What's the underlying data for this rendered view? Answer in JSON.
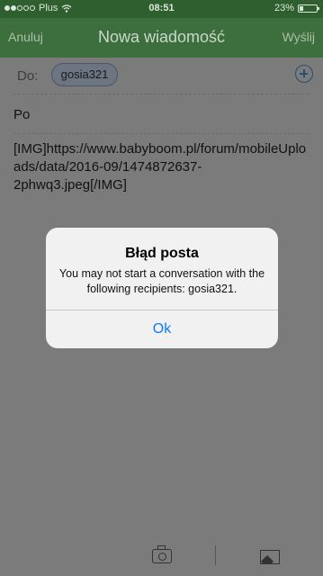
{
  "status_bar": {
    "carrier": "Plus",
    "time": "08:51",
    "battery_percent": "23%",
    "battery_level": 0.23,
    "signal_filled_dots": 2,
    "signal_total_dots": 5
  },
  "nav": {
    "cancel_label": "Anuluj",
    "title": "Nowa wiadomość",
    "send_label": "Wyślij"
  },
  "compose": {
    "to_label": "Do:",
    "recipient": "gosia321",
    "subject": "Po",
    "body": "[IMG]https://www.babyboom.pl/forum/mobileUploads/data/2016-09/1474872637-2phwq3.jpeg[/IMG]"
  },
  "toolbar": {
    "icons": [
      "camera-icon",
      "image-icon"
    ]
  },
  "dialog": {
    "title": "Błąd posta",
    "message": "You may not start a conversation with the following recipients: gosia321.",
    "ok_label": "Ok"
  },
  "colors": {
    "nav_bar": "#3d6e3d",
    "dialog_button": "#0a79ff"
  }
}
